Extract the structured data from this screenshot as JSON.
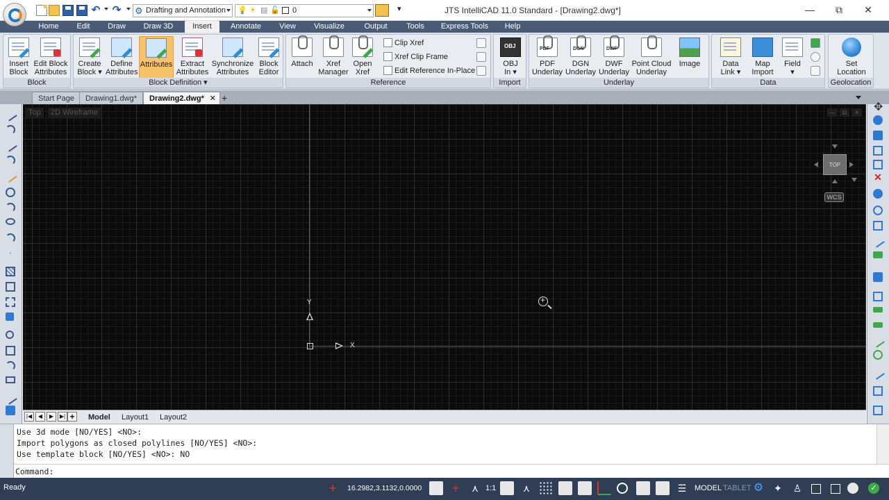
{
  "app": {
    "window_title": "JTS IntelliCAD 11.0 Standard - [Drawing2.dwg*]",
    "workspace": "Drafting and Annotation",
    "layer": "0",
    "window_controls": {
      "minimize": "—",
      "maximize": "⧉",
      "close": "✕"
    }
  },
  "ribbon": {
    "tabs": [
      "Home",
      "Edit",
      "Draw",
      "Draw 3D",
      "Insert",
      "Annotate",
      "View",
      "Visualize",
      "Output",
      "Tools",
      "Express Tools",
      "Help"
    ],
    "active_tab": "Insert",
    "panels": {
      "block": {
        "title": "Block",
        "buttons": [
          [
            "Insert",
            "Block"
          ],
          [
            "Edit Block",
            "Attributes"
          ]
        ]
      },
      "block_definition": {
        "title": "Block Definition ▾",
        "buttons": [
          [
            "Create",
            "Block ▾"
          ],
          [
            "Define",
            "Attributes"
          ],
          [
            "Attributes",
            ""
          ],
          [
            "Extract",
            "Attributes"
          ],
          [
            "Synchronize",
            "Attributes"
          ],
          [
            "Block",
            "Editor"
          ]
        ]
      },
      "reference": {
        "title": "Reference",
        "buttons": [
          [
            "Attach",
            ""
          ],
          [
            "Xref",
            "Manager"
          ],
          [
            "Open",
            "Xref"
          ]
        ],
        "small": [
          "Clip Xref",
          "Xref Clip Frame",
          "Edit Reference In-Place"
        ]
      },
      "import": {
        "title": "Import",
        "buttons": [
          [
            "OBJ",
            "In ▾"
          ]
        ],
        "tag": "OBJ"
      },
      "underlay": {
        "title": "Underlay",
        "buttons": [
          [
            "PDF",
            "Underlay"
          ],
          [
            "DGN",
            "Underlay"
          ],
          [
            "DWF",
            "Underlay"
          ],
          [
            "Point Cloud",
            "Underlay"
          ],
          [
            "Image",
            ""
          ]
        ],
        "tags": [
          "PDF",
          "DGN",
          "DWF"
        ]
      },
      "data": {
        "title": "Data",
        "buttons": [
          [
            "Data",
            "Link ▾"
          ],
          [
            "Map",
            "Import"
          ],
          [
            "Field",
            "▾"
          ]
        ]
      },
      "geolocation": {
        "title": "Geolocation",
        "buttons": [
          [
            "Set",
            "Location"
          ]
        ]
      }
    }
  },
  "doc_tabs": [
    "Start Page",
    "Drawing1.dwg*",
    "Drawing2.dwg*"
  ],
  "doc_tab_close": "✕",
  "doc_tab_add": "+",
  "canvas": {
    "view_labels": [
      "Top",
      "2D Wireframe"
    ],
    "navcube_face": "TOP",
    "wcs": "WCS",
    "axis_x": "X",
    "axis_y": "Y",
    "background": "#0b0b0b"
  },
  "layout_tabs": {
    "nav": [
      "|◀",
      "◀",
      "▶",
      "▶|",
      "+"
    ],
    "tabs": [
      "Model",
      "Layout1",
      "Layout2"
    ]
  },
  "command": {
    "history": [
      "Use 3d mode [NO/YES] <NO>:",
      "Import polygons as closed polylines [NO/YES] <NO>:",
      "Use template block [NO/YES] <NO>: NO"
    ],
    "prompt": "Command:"
  },
  "status": {
    "text": "Ready",
    "coords": "16.2982,3.1132,0.0000",
    "scale": "1:1",
    "model": "MODEL",
    "tablet": "TABLET"
  },
  "colors": {
    "ribbon_tabs": "#4a5b78",
    "statusbar": "#2f3d55",
    "active_button": "#f7c26a"
  }
}
